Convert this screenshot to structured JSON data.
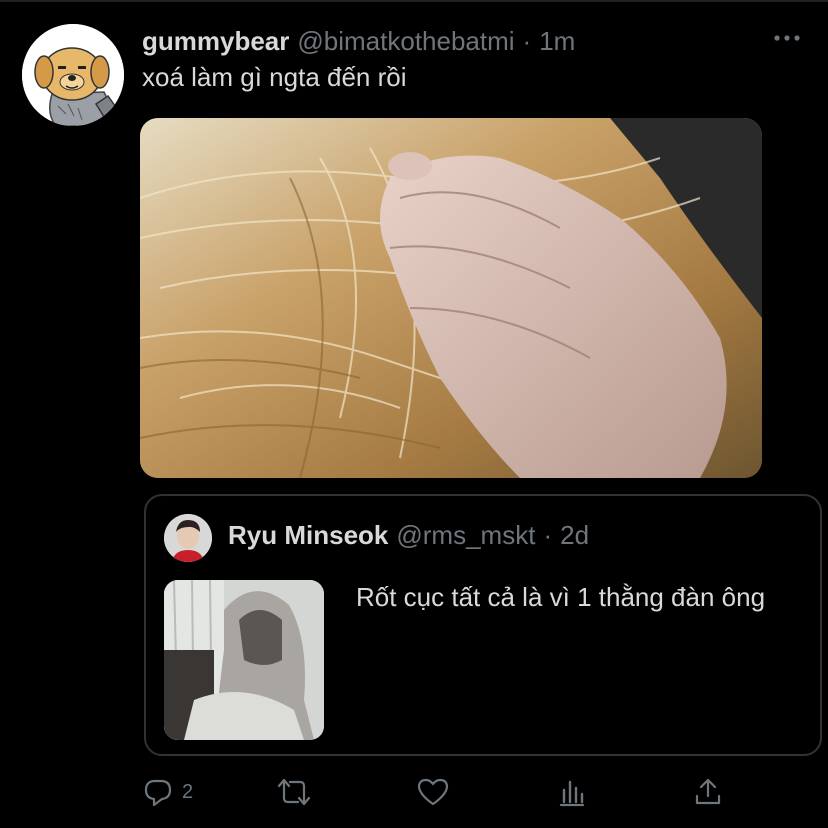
{
  "tweet": {
    "display_name": "gummybear",
    "handle": "@bimatkothebatmi",
    "separator": "·",
    "time": "1m",
    "text": "xoá làm gì ngta đến rồi",
    "avatar_icon": "dog-avatar-icon",
    "more_icon": "more-icon",
    "image_alt": "hand-in-blonde-hair-photo"
  },
  "quote": {
    "display_name": "Ryu Minseok",
    "handle": "@rms_mskt",
    "separator": "·",
    "time": "2d",
    "text": "Rốt cục tất cả là vì 1 thằng đàn ông",
    "avatar_icon": "user-avatar-icon",
    "image_alt": "hooded-figure-photo"
  },
  "actions": {
    "reply_count": "2",
    "reply_icon": "reply-icon",
    "retweet_icon": "retweet-icon",
    "like_icon": "heart-icon",
    "analytics_icon": "analytics-icon",
    "share_icon": "share-icon"
  },
  "colors": {
    "background": "#000000",
    "text_primary": "#d9d9d9",
    "text_secondary": "#6e767d",
    "border": "#2f3336"
  }
}
